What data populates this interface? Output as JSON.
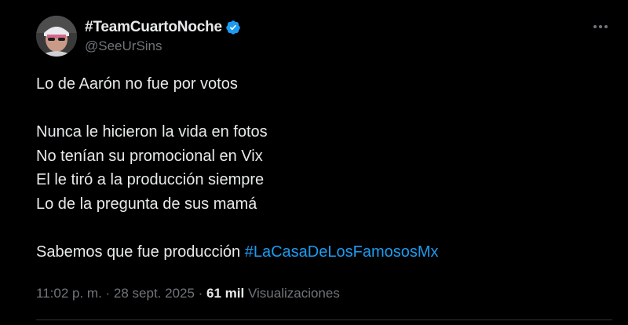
{
  "author": {
    "display_name": "#TeamCuartoNoche",
    "handle": "@SeeUrSins",
    "verified": true,
    "verified_color": "#1d9bf0",
    "avatar_icon": "avatar-photo"
  },
  "more_icon": "more-options-icon",
  "tweet": {
    "lines": [
      "Lo de Aarón no fue por votos",
      "",
      "Nunca le hicieron la vida en fotos",
      "No tenían su promocional en Vix",
      "El le tiró a la producción siempre",
      "Lo de la pregunta de sus mamá",
      ""
    ],
    "last_line_text": "Sabemos que fue producción ",
    "hashtag": "#LaCasaDeLosFamososMx",
    "hashtag_color": "#1d9bf0"
  },
  "meta": {
    "time": "11:02 p. m.",
    "separator": " · ",
    "date": "28 sept. 2025",
    "separator2": " · ",
    "views_count": "61 mil",
    "views_label": " Visualizaciones"
  }
}
